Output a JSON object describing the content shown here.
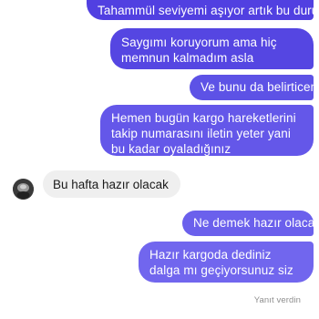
{
  "conversation": {
    "sent_messages": [
      "Tahammül seviyemi aşıyor artık bu durum",
      "Saygımı koruyorum ama hiç memnun kalmadım asla",
      "Ve bunu da belirticem",
      "Hemen bugün kargo hareketlerini takip numarasını iletin yeter yani bu kadar oyaladığınız",
      "Ne demek hazır olacak",
      "Hazır kargoda dediniz dalga mı geçiyorsunuz siz"
    ],
    "received_message": "Bu hafta hazır olacak",
    "seen_status": "Yanıt verdin"
  },
  "colors": {
    "sent_bubble": "#5b4fe0",
    "received_bubble": "#efefef",
    "seen_text": "#8e8e8e"
  }
}
